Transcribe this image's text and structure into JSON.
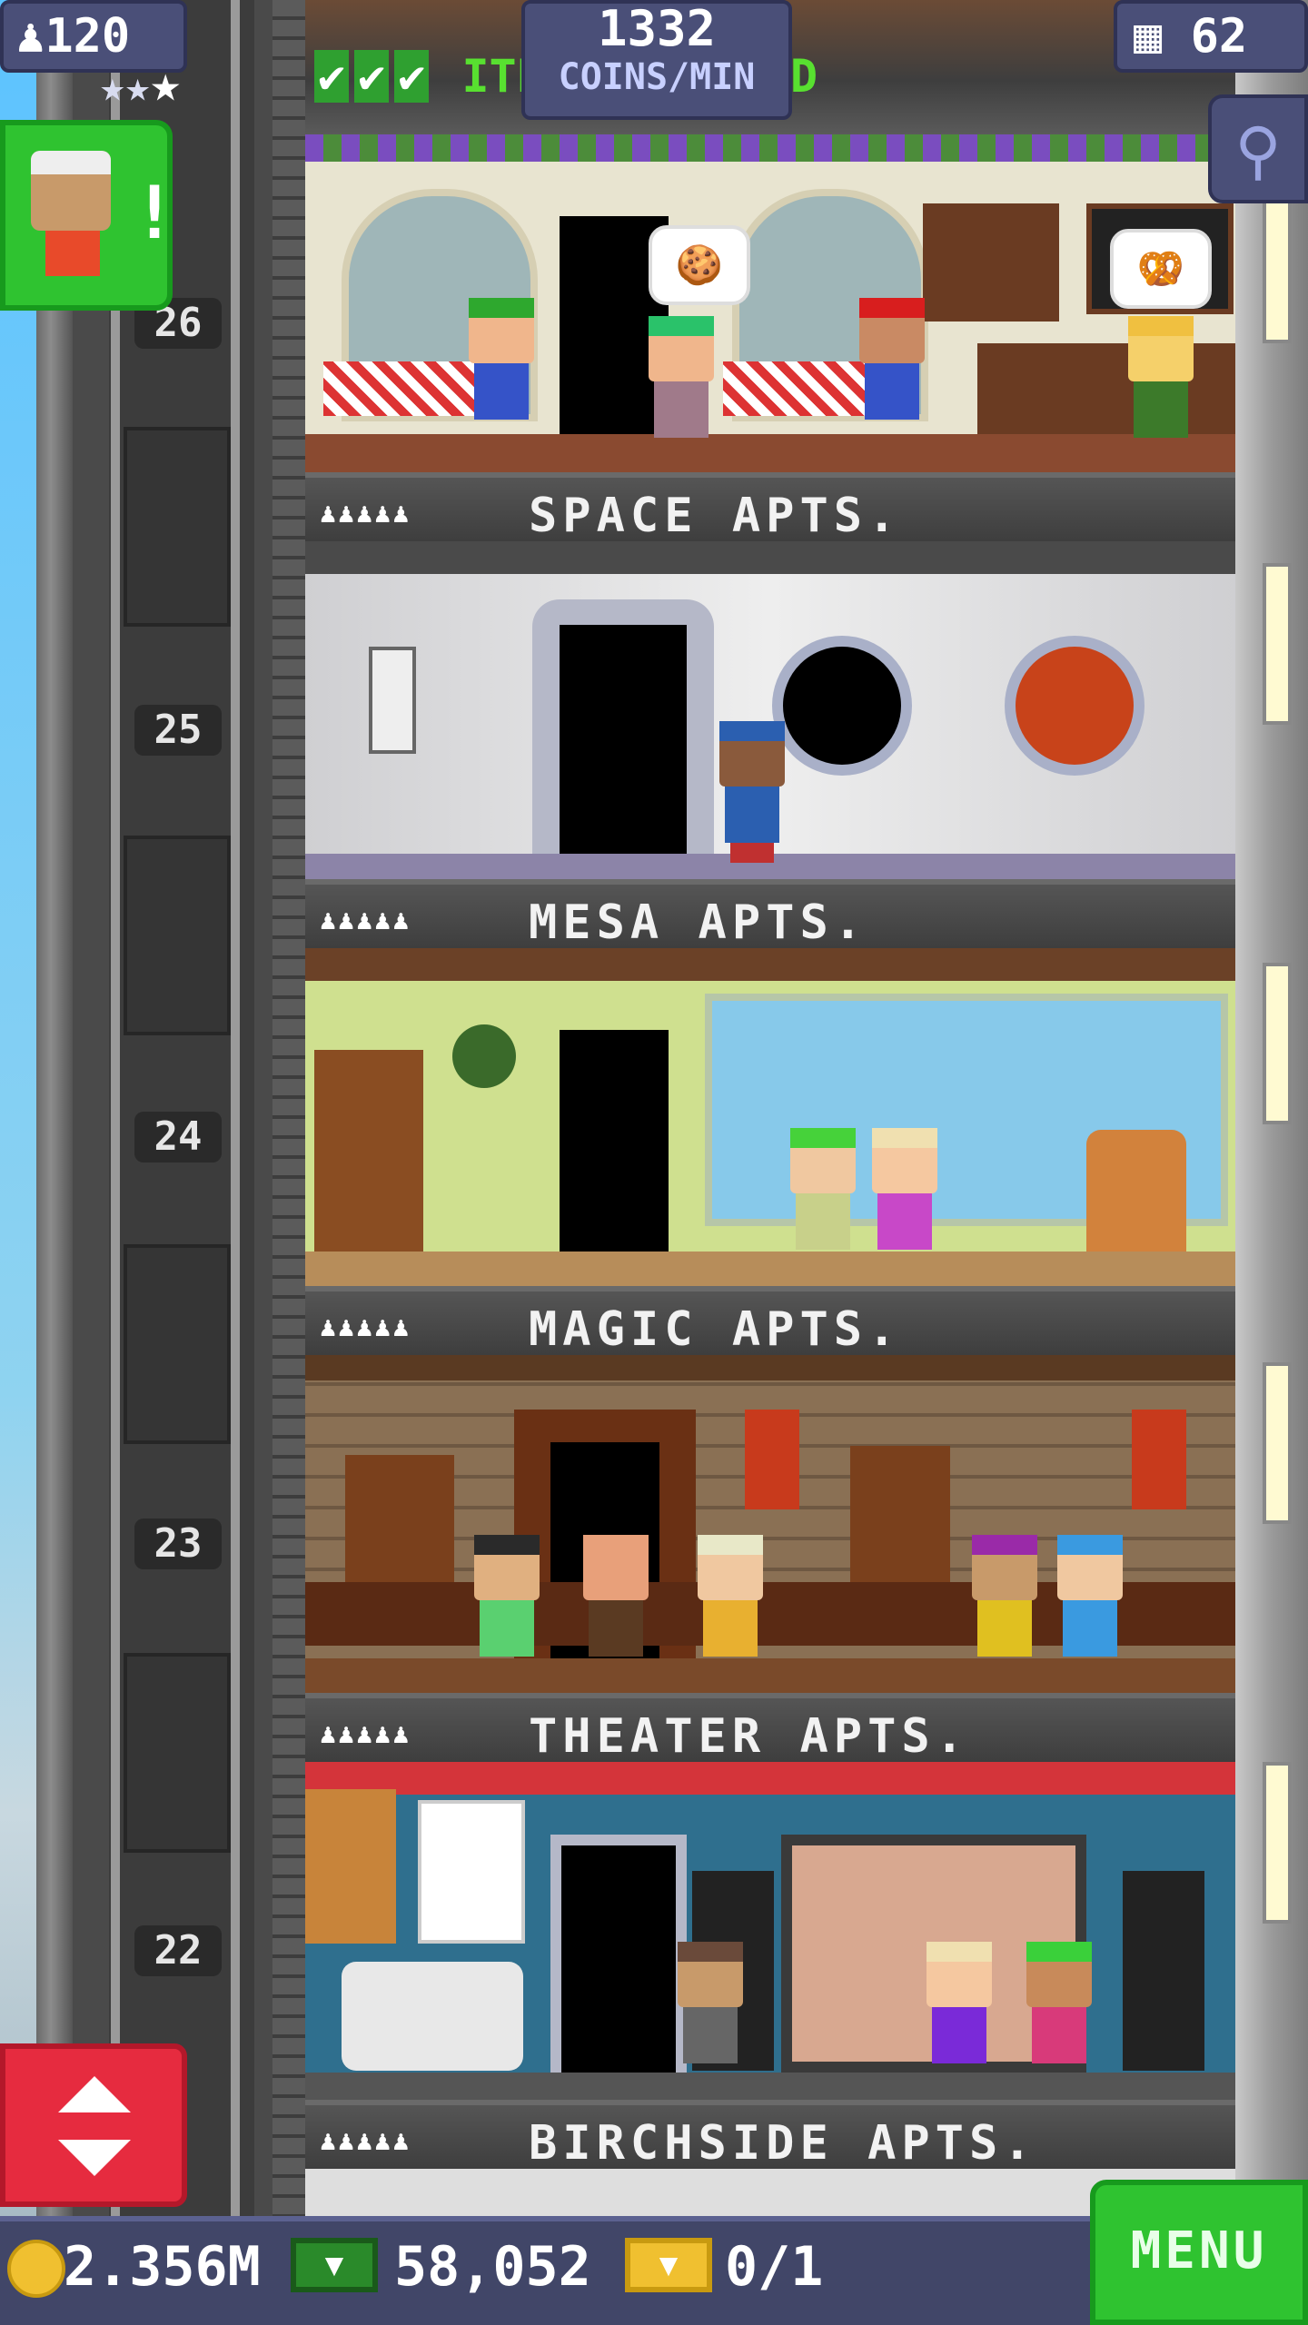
{
  "hud": {
    "population": "120",
    "coins_per_min_value": "1332",
    "coins_per_min_label": "COINS/MIN",
    "ticker_text": "ITE",
    "ticker_suffix": "D",
    "floors_count": "62"
  },
  "notification": {
    "badge": "!"
  },
  "floors": [
    {
      "number": "26",
      "name": "SPACE APTS.",
      "room_type": "restaurant"
    },
    {
      "number": "25",
      "name": "MESA APTS.",
      "room_type": "space-station"
    },
    {
      "number": "24",
      "name": "MAGIC APTS.",
      "room_type": "apartment"
    },
    {
      "number": "23",
      "name": "THEATER APTS.",
      "room_type": "library"
    },
    {
      "number": "22",
      "name": "BIRCHSIDE APTS.",
      "room_type": "theater"
    }
  ],
  "bubbles": {
    "cookie": "🍪",
    "pretzel": "🥨"
  },
  "bottom_bar": {
    "coins": "2.356M",
    "bux": "58,052",
    "tickets": "0/1",
    "menu_label": "MENU"
  },
  "colors": {
    "menu_green": "#2fc330",
    "elevator_red": "#e62b3f",
    "hud_blue": "#4a4f78"
  }
}
